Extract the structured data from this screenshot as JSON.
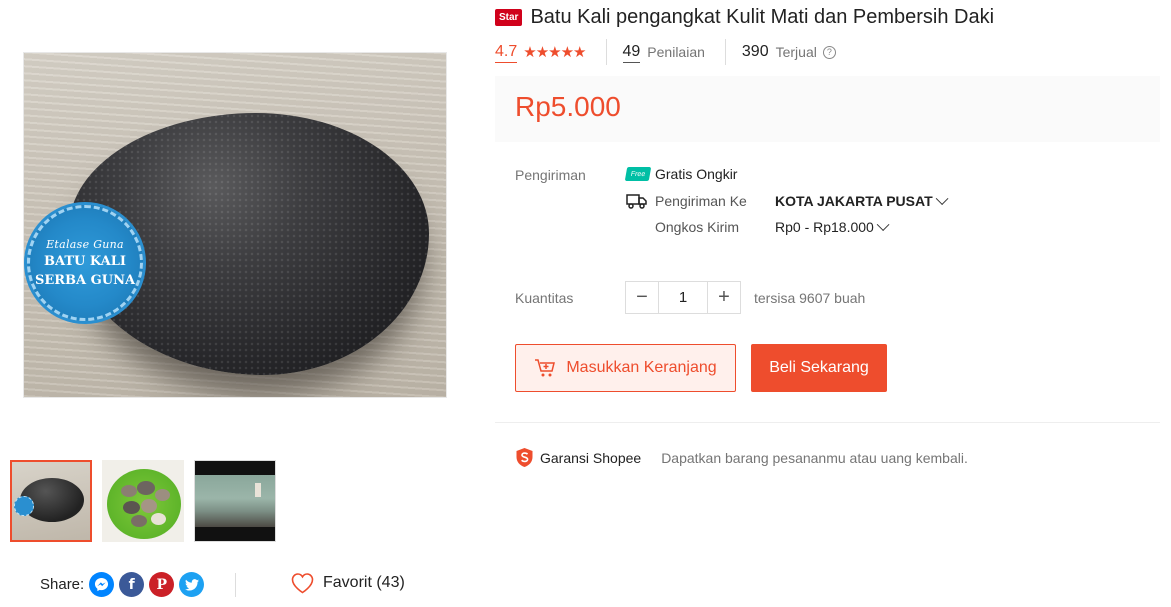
{
  "gallery": {
    "seal_line1": "Etalase Guna",
    "seal_line2": "BATU KALI",
    "seal_line3": "SERBA GUNA",
    "thumbnails": [
      "image-1",
      "image-2",
      "video-3"
    ]
  },
  "share": {
    "label": "Share:",
    "f_glyph": "f",
    "p_glyph": "P"
  },
  "favorite": {
    "label": "Favorit (43)"
  },
  "product": {
    "badge": "Star",
    "title": "Batu Kali pengangkat Kulit Mati dan Pembersih Daki"
  },
  "rating": {
    "value": "4.7",
    "stars": 4.7,
    "count": "49",
    "count_label": "Penilaian",
    "sold": "390",
    "sold_label": "Terjual",
    "help_glyph": "?"
  },
  "price": "Rp5.000",
  "shipping": {
    "label": "Pengiriman",
    "free_tag": "Free",
    "free_text": "Gratis Ongkir",
    "to_label": "Pengiriman Ke",
    "to_value": "KOTA JAKARTA PUSAT",
    "cost_label": "Ongkos Kirim",
    "cost_value": "Rp0 - Rp18.000"
  },
  "quantity": {
    "label": "Kuantitas",
    "minus": "−",
    "value": "1",
    "plus": "+",
    "stock": "tersisa 9607 buah"
  },
  "actions": {
    "add_to_cart": "Masukkan Keranjang",
    "buy_now": "Beli Sekarang"
  },
  "guarantee": {
    "title": "Garansi Shopee",
    "text": "Dapatkan barang pesananmu atau uang kembali."
  },
  "colors": {
    "accent": "#ee4d2d",
    "badge": "#d0011b",
    "free_shipping": "#00bfa5"
  }
}
